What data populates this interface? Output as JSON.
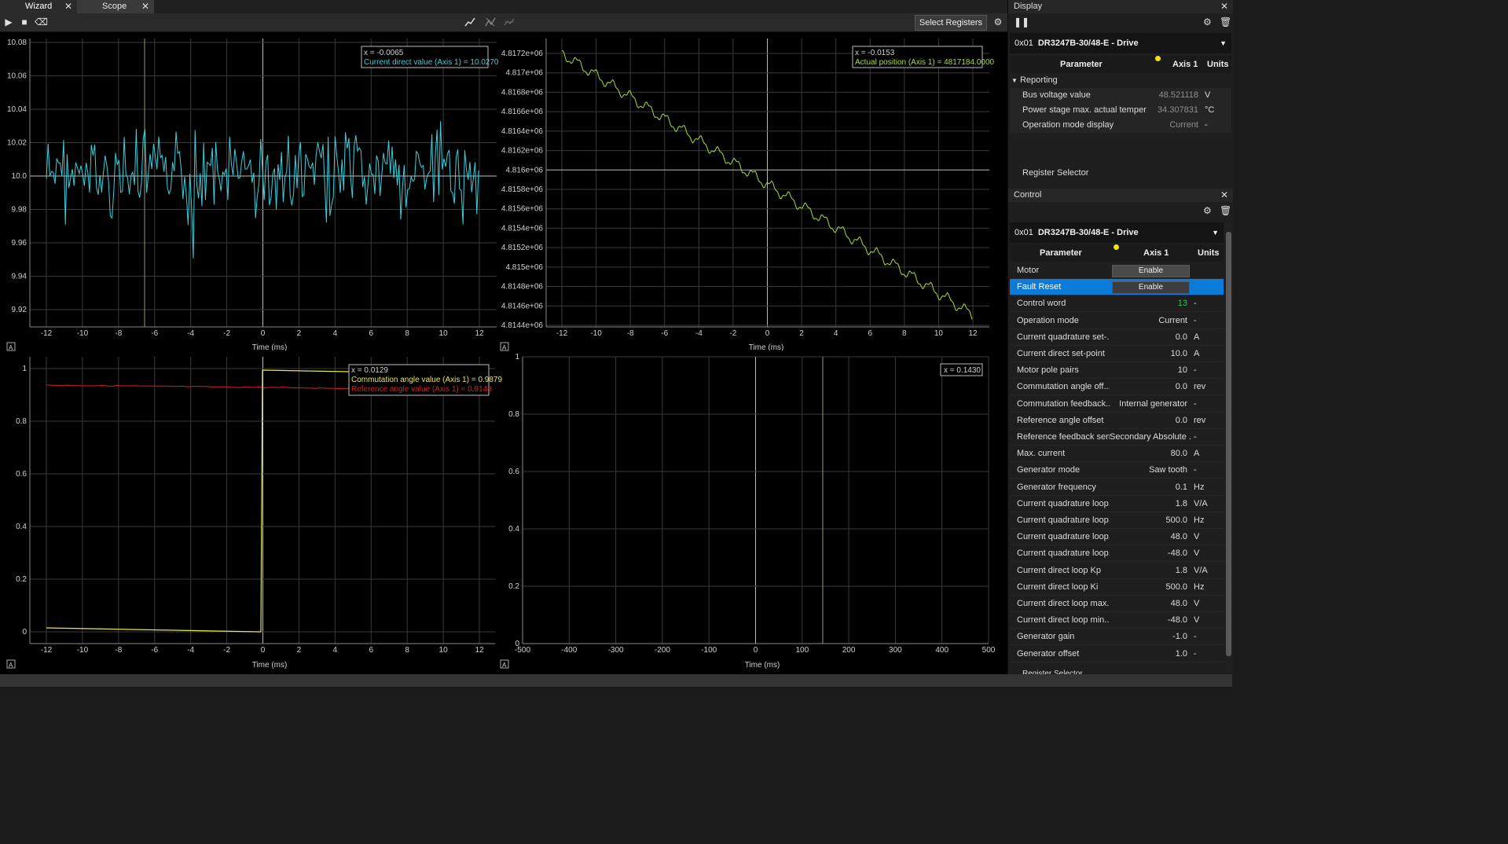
{
  "tabs": [
    {
      "label": "Wizard"
    },
    {
      "label": "Scope"
    }
  ],
  "toolbar": {
    "select_registers": "Select Registers"
  },
  "plots": [
    {
      "id": "tl",
      "xlabel": "Time (ms)",
      "xticks": [
        "-12",
        "-10",
        "-8",
        "-6",
        "-4",
        "-2",
        "0",
        "2",
        "4",
        "6",
        "8",
        "10",
        "12"
      ],
      "yticks": [
        "10.08",
        "10.06",
        "10.04",
        "10.02",
        "10.0",
        "9.98",
        "9.96",
        "9.94",
        "9.92"
      ],
      "tooltip": [
        "x = -0.0065",
        "Current direct value (Axis 1) = 10.0270"
      ],
      "color": "#3ad0de"
    },
    {
      "id": "tr",
      "xlabel": "Time (ms)",
      "xticks": [
        "-12",
        "-10",
        "-8",
        "-6",
        "-4",
        "-2",
        "0",
        "2",
        "4",
        "6",
        "8",
        "10",
        "12"
      ],
      "yticks": [
        "4.8172e+06",
        "4.817e+06",
        "4.8168e+06",
        "4.8166e+06",
        "4.8164e+06",
        "4.8162e+06",
        "4.816e+06",
        "4.8158e+06",
        "4.8156e+06",
        "4.8154e+06",
        "4.8152e+06",
        "4.815e+06",
        "4.8148e+06",
        "4.8146e+06",
        "4.8144e+06"
      ],
      "tooltip": [
        "x = -0.0153",
        "Actual position (Axis 1) = 4817184.0000"
      ],
      "color": "#a6de2c"
    },
    {
      "id": "bl",
      "xlabel": "Time (ms)",
      "xticks": [
        "-12",
        "-10",
        "-8",
        "-6",
        "-4",
        "-2",
        "0",
        "2",
        "4",
        "6",
        "8",
        "10",
        "12"
      ],
      "yticks": [
        "1",
        "0.8",
        "0.6",
        "0.4",
        "0.2",
        "0"
      ],
      "tooltip": [
        "x = 0.0129",
        "Commutation angle value (Axis 1) = 0.9879",
        "Reference angle value (Axis 1) = 0.9148"
      ],
      "color": "#e8e84a",
      "color2": "#d42020"
    },
    {
      "id": "br",
      "xlabel": "Time (ms)",
      "xticks": [
        "-500",
        "-400",
        "-300",
        "-200",
        "-100",
        "0",
        "100",
        "200",
        "300",
        "400",
        "500"
      ],
      "yticks": [
        "1",
        "0.8",
        "0.6",
        "0.4",
        "0.2",
        "0"
      ],
      "tooltip": [
        "x = 0.1430"
      ]
    }
  ],
  "display": {
    "title": "Display",
    "device_addr": "0x01",
    "device_name": "DR3247B-30/48-E - Drive",
    "col_parameter": "Parameter",
    "col_axis": "Axis 1",
    "col_units": "Units",
    "group": "Reporting",
    "rows": [
      {
        "name": "Bus voltage value",
        "value": "48.521118",
        "unit": "V"
      },
      {
        "name": "Power stage max. actual temperat...",
        "value": "34.307831",
        "unit": "°C"
      },
      {
        "name": "Operation mode display",
        "value": "Current",
        "unit": "-"
      }
    ],
    "register_selector": "Register Selector"
  },
  "control": {
    "title": "Control",
    "device_addr": "0x01",
    "device_name": "DR3247B-30/48-E - Drive",
    "col_parameter": "Parameter",
    "col_axis": "Axis 1",
    "col_units": "Units",
    "rows": [
      {
        "name": "Motor",
        "button": "Enable",
        "unit": ""
      },
      {
        "name": "Fault Reset",
        "button": "Enable",
        "unit": "",
        "selected": true
      },
      {
        "name": "Control word",
        "value": "13",
        "unit": "-",
        "accent": true
      },
      {
        "name": "Operation mode",
        "value": "Current",
        "unit": "-"
      },
      {
        "name": "Current quadrature set-...",
        "value": "0.0",
        "unit": "A"
      },
      {
        "name": "Current direct set-point",
        "value": "10.0",
        "unit": "A"
      },
      {
        "name": "Motor pole pairs",
        "value": "10",
        "unit": "-"
      },
      {
        "name": "Commutation angle off...",
        "value": "0.0",
        "unit": "rev"
      },
      {
        "name": "Commutation feedback...",
        "value": "Internal generator",
        "unit": "-"
      },
      {
        "name": "Reference angle offset",
        "value": "0.0",
        "unit": "rev"
      },
      {
        "name": "Reference feedback sen...",
        "value": "Secondary Absolute ...",
        "unit": "-"
      },
      {
        "name": "Max. current",
        "value": "80.0",
        "unit": "A"
      },
      {
        "name": "Generator mode",
        "value": "Saw tooth",
        "unit": "-"
      },
      {
        "name": "Generator frequency",
        "value": "0.1",
        "unit": "Hz"
      },
      {
        "name": "Current quadrature loop...",
        "value": "1.8",
        "unit": "V/A"
      },
      {
        "name": "Current quadrature loop...",
        "value": "500.0",
        "unit": "Hz"
      },
      {
        "name": "Current quadrature loop...",
        "value": "48.0",
        "unit": "V"
      },
      {
        "name": "Current quadrature loop...",
        "value": "-48.0",
        "unit": "V"
      },
      {
        "name": "Current direct loop Kp",
        "value": "1.8",
        "unit": "V/A"
      },
      {
        "name": "Current direct loop Ki",
        "value": "500.0",
        "unit": "Hz"
      },
      {
        "name": "Current direct loop max...",
        "value": "48.0",
        "unit": "V"
      },
      {
        "name": "Current direct loop min...",
        "value": "-48.0",
        "unit": "V"
      },
      {
        "name": "Generator gain",
        "value": "-1.0",
        "unit": "-"
      },
      {
        "name": "Generator offset",
        "value": "1.0",
        "unit": "-"
      }
    ],
    "register_selector": "Register Selector"
  }
}
